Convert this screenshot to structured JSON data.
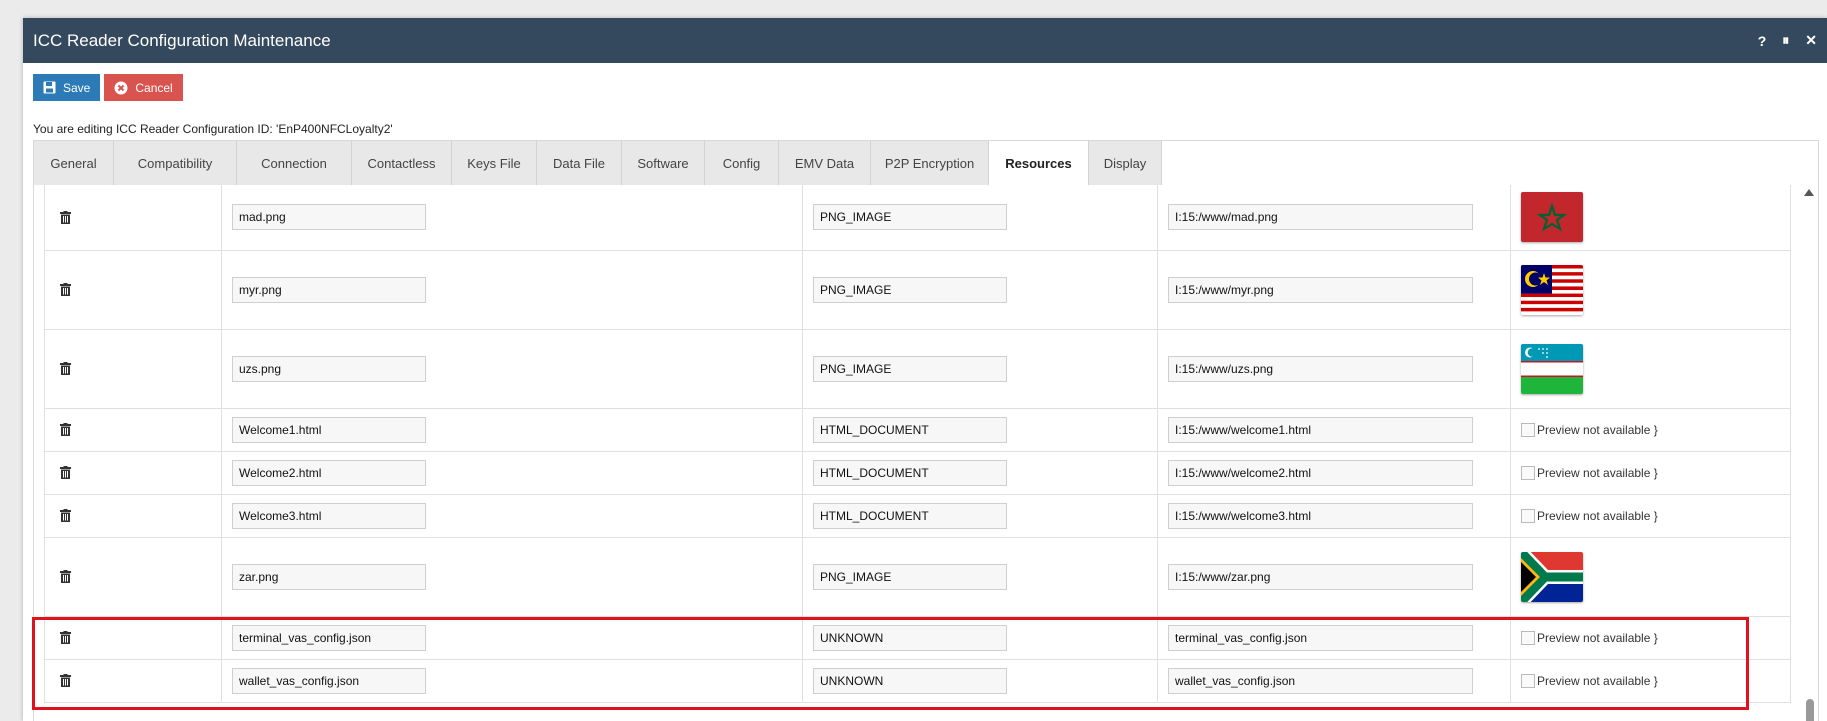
{
  "window": {
    "title": "ICC Reader Configuration Maintenance",
    "help_label": "?",
    "pause_label": "⏸",
    "close_label": "✕"
  },
  "toolbar": {
    "save_label": "Save",
    "cancel_label": "Cancel"
  },
  "edit_message": "You are editing ICC Reader Configuration ID: 'EnP400NFCLoyalty2'",
  "tabs": [
    "General",
    "Compatibility",
    "Connection",
    "Contactless",
    "Keys File",
    "Data File",
    "Software",
    "Config",
    "EMV Data",
    "P2P Encryption",
    "Resources",
    "Display"
  ],
  "active_tab": "Resources",
  "rows": [
    {
      "name": "mad.png",
      "type": "PNG_IMAGE",
      "path": "I:15:/www/mad.png",
      "preview": "flag-morocco"
    },
    {
      "name": "myr.png",
      "type": "PNG_IMAGE",
      "path": "I:15:/www/myr.png",
      "preview": "flag-malaysia"
    },
    {
      "name": "uzs.png",
      "type": "PNG_IMAGE",
      "path": "I:15:/www/uzs.png",
      "preview": "flag-uzbekistan"
    },
    {
      "name": "Welcome1.html",
      "type": "HTML_DOCUMENT",
      "path": "I:15:/www/welcome1.html",
      "preview_text": "Preview not available }"
    },
    {
      "name": "Welcome2.html",
      "type": "HTML_DOCUMENT",
      "path": "I:15:/www/welcome2.html",
      "preview_text": "Preview not available }"
    },
    {
      "name": "Welcome3.html",
      "type": "HTML_DOCUMENT",
      "path": "I:15:/www/welcome3.html",
      "preview_text": "Preview not available }"
    },
    {
      "name": "zar.png",
      "type": "PNG_IMAGE",
      "path": "I:15:/www/zar.png",
      "preview": "flag-south-africa"
    },
    {
      "name": "terminal_vas_config.json",
      "type": "UNKNOWN",
      "path": "terminal_vas_config.json",
      "preview_text": "Preview not available }"
    },
    {
      "name": "wallet_vas_config.json",
      "type": "UNKNOWN",
      "path": "wallet_vas_config.json",
      "preview_text": "Preview not available }"
    }
  ],
  "colors": {
    "title_bar": "#34495e",
    "save_button": "#2c7bb6",
    "cancel_button": "#d9534f",
    "highlight_box": "#e0121c"
  }
}
